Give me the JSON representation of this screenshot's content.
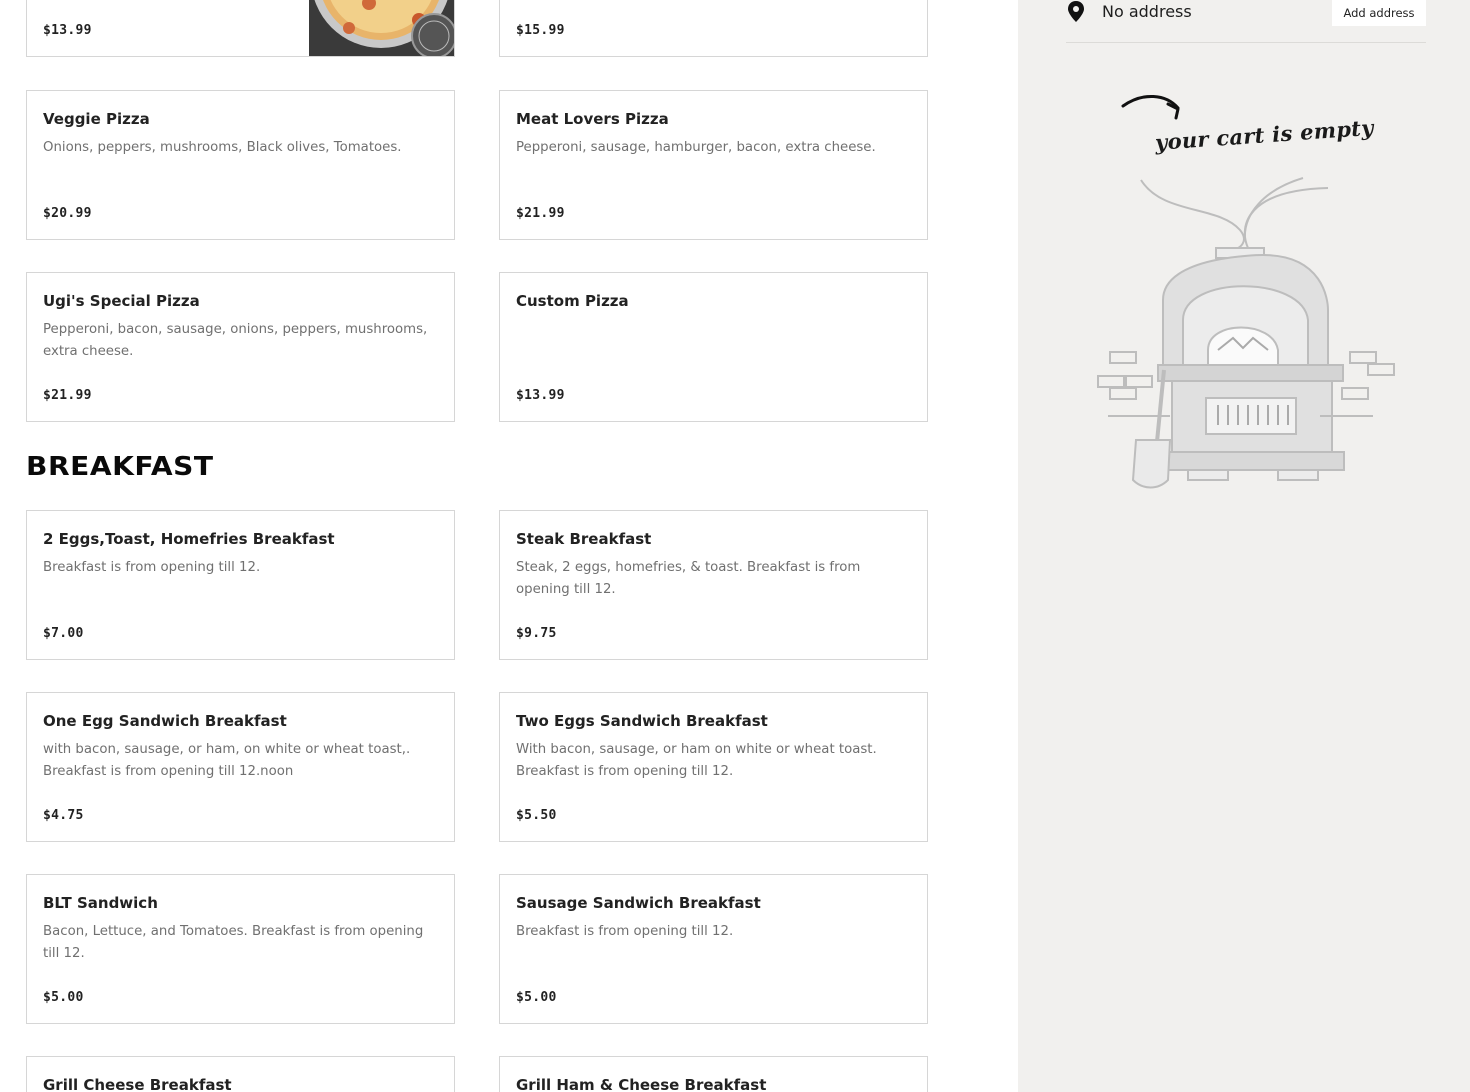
{
  "menu": {
    "top_items": [
      {
        "name": "",
        "description": "",
        "price": "$13.99"
      },
      {
        "name": "",
        "description": "",
        "price": "$15.99"
      }
    ],
    "items": [
      {
        "name": "Veggie Pizza",
        "description": "Onions, peppers, mushrooms, Black olives, Tomatoes.",
        "price": "$20.99"
      },
      {
        "name": "Meat Lovers Pizza",
        "description": "Pepperoni, sausage, hamburger, bacon, extra cheese.",
        "price": "$21.99"
      },
      {
        "name": "Ugi's Special Pizza",
        "description": "Pepperoni, bacon, sausage, onions, peppers, mushrooms, extra cheese.",
        "price": "$21.99"
      },
      {
        "name": "Custom Pizza",
        "description": "",
        "price": "$13.99"
      }
    ],
    "breakfast_title": "BREAKFAST",
    "breakfast_items": [
      {
        "name": "2 Eggs,Toast, Homefries Breakfast",
        "description": "Breakfast is from opening till 12.",
        "price": "$7.00"
      },
      {
        "name": "Steak Breakfast",
        "description": "Steak, 2 eggs, homefries, & toast. Breakfast is from opening till 12.",
        "price": "$9.75"
      },
      {
        "name": "One Egg Sandwich Breakfast",
        "description": "with bacon, sausage, or ham, on white or wheat toast,. Breakfast is from opening till 12.noon",
        "price": "$4.75"
      },
      {
        "name": "Two Eggs Sandwich Breakfast",
        "description": "With bacon, sausage, or ham on white or wheat toast. Breakfast is from opening till 12.",
        "price": "$5.50"
      },
      {
        "name": "BLT Sandwich",
        "description": "Bacon, Lettuce, and Tomatoes. Breakfast is from opening till 12.",
        "price": "$5.00"
      },
      {
        "name": "Sausage Sandwich Breakfast",
        "description": "Breakfast is from opening till 12.",
        "price": "$5.00"
      },
      {
        "name": "Grill Cheese Breakfast",
        "description": "",
        "price": ""
      },
      {
        "name": "Grill Ham & Cheese Breakfast",
        "description": "",
        "price": ""
      }
    ]
  },
  "cart": {
    "address_text": "No address",
    "add_address_label": "Add address",
    "empty_message": "your cart is empty",
    "icons": {
      "pin": "location-pin-icon",
      "arrow": "curved-arrow-icon",
      "oven": "pizza-oven-illustration"
    }
  },
  "colors": {
    "sidebar_bg": "#f1f0ee",
    "card_border": "#d6d6d6",
    "description": "#707070",
    "title": "#0a0a0a"
  }
}
